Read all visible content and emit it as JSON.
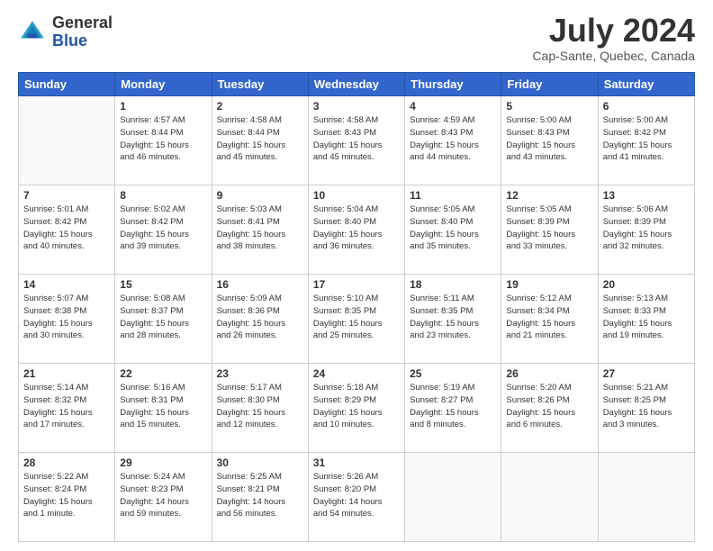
{
  "header": {
    "logo_general": "General",
    "logo_blue": "Blue",
    "month_year": "July 2024",
    "location": "Cap-Sante, Quebec, Canada"
  },
  "days_of_week": [
    "Sunday",
    "Monday",
    "Tuesday",
    "Wednesday",
    "Thursday",
    "Friday",
    "Saturday"
  ],
  "weeks": [
    [
      {
        "day": "",
        "text": ""
      },
      {
        "day": "1",
        "text": "Sunrise: 4:57 AM\nSunset: 8:44 PM\nDaylight: 15 hours\nand 46 minutes."
      },
      {
        "day": "2",
        "text": "Sunrise: 4:58 AM\nSunset: 8:44 PM\nDaylight: 15 hours\nand 45 minutes."
      },
      {
        "day": "3",
        "text": "Sunrise: 4:58 AM\nSunset: 8:43 PM\nDaylight: 15 hours\nand 45 minutes."
      },
      {
        "day": "4",
        "text": "Sunrise: 4:59 AM\nSunset: 8:43 PM\nDaylight: 15 hours\nand 44 minutes."
      },
      {
        "day": "5",
        "text": "Sunrise: 5:00 AM\nSunset: 8:43 PM\nDaylight: 15 hours\nand 43 minutes."
      },
      {
        "day": "6",
        "text": "Sunrise: 5:00 AM\nSunset: 8:42 PM\nDaylight: 15 hours\nand 41 minutes."
      }
    ],
    [
      {
        "day": "7",
        "text": "Sunrise: 5:01 AM\nSunset: 8:42 PM\nDaylight: 15 hours\nand 40 minutes."
      },
      {
        "day": "8",
        "text": "Sunrise: 5:02 AM\nSunset: 8:42 PM\nDaylight: 15 hours\nand 39 minutes."
      },
      {
        "day": "9",
        "text": "Sunrise: 5:03 AM\nSunset: 8:41 PM\nDaylight: 15 hours\nand 38 minutes."
      },
      {
        "day": "10",
        "text": "Sunrise: 5:04 AM\nSunset: 8:40 PM\nDaylight: 15 hours\nand 36 minutes."
      },
      {
        "day": "11",
        "text": "Sunrise: 5:05 AM\nSunset: 8:40 PM\nDaylight: 15 hours\nand 35 minutes."
      },
      {
        "day": "12",
        "text": "Sunrise: 5:05 AM\nSunset: 8:39 PM\nDaylight: 15 hours\nand 33 minutes."
      },
      {
        "day": "13",
        "text": "Sunrise: 5:06 AM\nSunset: 8:39 PM\nDaylight: 15 hours\nand 32 minutes."
      }
    ],
    [
      {
        "day": "14",
        "text": "Sunrise: 5:07 AM\nSunset: 8:38 PM\nDaylight: 15 hours\nand 30 minutes."
      },
      {
        "day": "15",
        "text": "Sunrise: 5:08 AM\nSunset: 8:37 PM\nDaylight: 15 hours\nand 28 minutes."
      },
      {
        "day": "16",
        "text": "Sunrise: 5:09 AM\nSunset: 8:36 PM\nDaylight: 15 hours\nand 26 minutes."
      },
      {
        "day": "17",
        "text": "Sunrise: 5:10 AM\nSunset: 8:35 PM\nDaylight: 15 hours\nand 25 minutes."
      },
      {
        "day": "18",
        "text": "Sunrise: 5:11 AM\nSunset: 8:35 PM\nDaylight: 15 hours\nand 23 minutes."
      },
      {
        "day": "19",
        "text": "Sunrise: 5:12 AM\nSunset: 8:34 PM\nDaylight: 15 hours\nand 21 minutes."
      },
      {
        "day": "20",
        "text": "Sunrise: 5:13 AM\nSunset: 8:33 PM\nDaylight: 15 hours\nand 19 minutes."
      }
    ],
    [
      {
        "day": "21",
        "text": "Sunrise: 5:14 AM\nSunset: 8:32 PM\nDaylight: 15 hours\nand 17 minutes."
      },
      {
        "day": "22",
        "text": "Sunrise: 5:16 AM\nSunset: 8:31 PM\nDaylight: 15 hours\nand 15 minutes."
      },
      {
        "day": "23",
        "text": "Sunrise: 5:17 AM\nSunset: 8:30 PM\nDaylight: 15 hours\nand 12 minutes."
      },
      {
        "day": "24",
        "text": "Sunrise: 5:18 AM\nSunset: 8:29 PM\nDaylight: 15 hours\nand 10 minutes."
      },
      {
        "day": "25",
        "text": "Sunrise: 5:19 AM\nSunset: 8:27 PM\nDaylight: 15 hours\nand 8 minutes."
      },
      {
        "day": "26",
        "text": "Sunrise: 5:20 AM\nSunset: 8:26 PM\nDaylight: 15 hours\nand 6 minutes."
      },
      {
        "day": "27",
        "text": "Sunrise: 5:21 AM\nSunset: 8:25 PM\nDaylight: 15 hours\nand 3 minutes."
      }
    ],
    [
      {
        "day": "28",
        "text": "Sunrise: 5:22 AM\nSunset: 8:24 PM\nDaylight: 15 hours\nand 1 minute."
      },
      {
        "day": "29",
        "text": "Sunrise: 5:24 AM\nSunset: 8:23 PM\nDaylight: 14 hours\nand 59 minutes."
      },
      {
        "day": "30",
        "text": "Sunrise: 5:25 AM\nSunset: 8:21 PM\nDaylight: 14 hours\nand 56 minutes."
      },
      {
        "day": "31",
        "text": "Sunrise: 5:26 AM\nSunset: 8:20 PM\nDaylight: 14 hours\nand 54 minutes."
      },
      {
        "day": "",
        "text": ""
      },
      {
        "day": "",
        "text": ""
      },
      {
        "day": "",
        "text": ""
      }
    ]
  ]
}
